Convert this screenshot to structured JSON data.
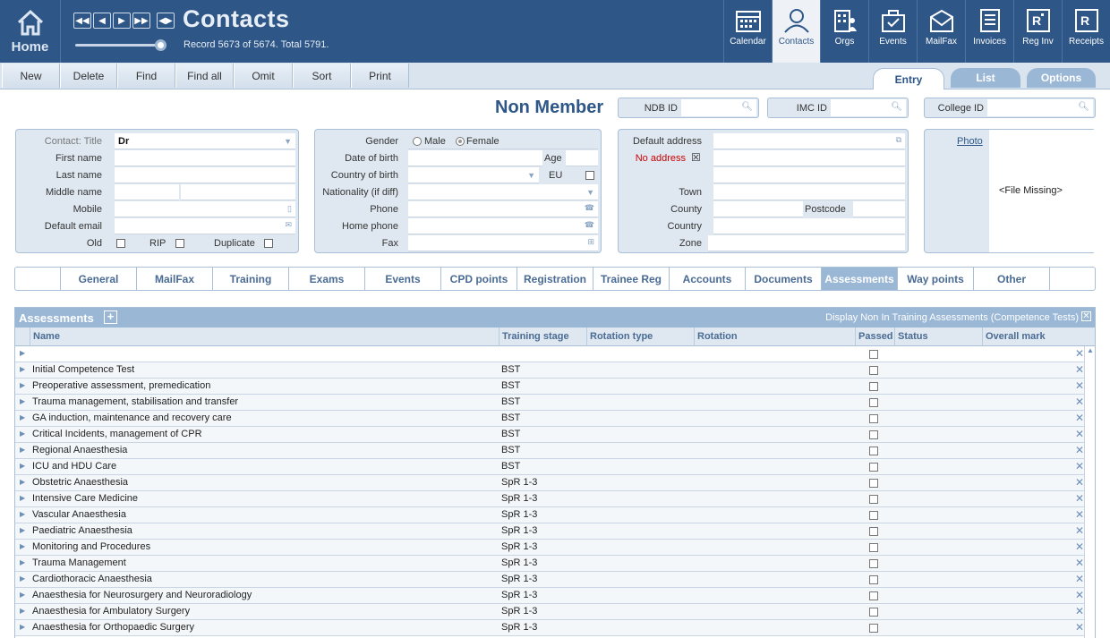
{
  "home_label": "Home",
  "page_title": "Contacts",
  "record_info": "Record 5673 of 5674. Total 5791.",
  "modules": [
    {
      "label": "Calendar",
      "icon": "calendar-icon"
    },
    {
      "label": "Contacts",
      "icon": "person-icon",
      "active": true
    },
    {
      "label": "Orgs",
      "icon": "building-icon"
    },
    {
      "label": "Events",
      "icon": "briefcase-icon"
    },
    {
      "label": "MailFax",
      "icon": "mail-icon"
    },
    {
      "label": "Invoices",
      "icon": "invoice-icon"
    },
    {
      "label": "Reg Inv",
      "icon": "reg-invoice-icon"
    },
    {
      "label": "Receipts",
      "icon": "receipt-icon"
    }
  ],
  "toolbar": {
    "new": "New",
    "delete": "Delete",
    "find": "Find",
    "find_all": "Find all",
    "omit": "Omit",
    "sort": "Sort",
    "print": "Print"
  },
  "view_tabs": {
    "entry": "Entry",
    "list": "List",
    "options": "Options"
  },
  "member_status": "Non Member",
  "ids": {
    "ndb": "NDB ID",
    "imc": "IMC ID",
    "college": "College ID"
  },
  "contact": {
    "title_label": "Contact: Title",
    "title_value": "Dr",
    "first_name": "First name",
    "last_name": "Last name",
    "middle_name": "Middle name",
    "mobile": "Mobile",
    "default_email": "Default email",
    "old": "Old",
    "rip": "RIP",
    "duplicate": "Duplicate"
  },
  "personal": {
    "gender": "Gender",
    "male": "Male",
    "female": "Female",
    "dob": "Date of birth",
    "age": "Age",
    "country_of_birth": "Country of birth",
    "eu": "EU",
    "nationality": "Nationality (if diff)",
    "phone": "Phone",
    "home_phone": "Home phone",
    "fax": "Fax"
  },
  "address": {
    "default_address": "Default address",
    "no_address": "No address",
    "town": "Town",
    "county": "County",
    "postcode": "Postcode",
    "country": "Country",
    "zone": "Zone"
  },
  "photo": {
    "label": "Photo",
    "missing": "<File Missing>"
  },
  "subtabs": [
    "",
    "General",
    "MailFax",
    "Training",
    "Exams",
    "Events",
    "CPD points",
    "Registration",
    "Trainee Reg",
    "Accounts",
    "Documents",
    "Assessments",
    "Way points",
    "Other",
    ""
  ],
  "active_subtab": "Assessments",
  "assessments": {
    "title": "Assessments",
    "display_toggle": "Display Non In Training Assessments (Competence Tests)",
    "columns": [
      "Name",
      "Training stage",
      "Rotation type",
      "Rotation",
      "Passed",
      "Status",
      "Overall mark"
    ],
    "rows": [
      {
        "name": "",
        "stage": ""
      },
      {
        "name": "Initial Competence Test",
        "stage": "BST"
      },
      {
        "name": "Preoperative assessment, premedication",
        "stage": "BST"
      },
      {
        "name": "Trauma management, stabilisation and transfer",
        "stage": "BST"
      },
      {
        "name": "GA induction, maintenance and recovery care",
        "stage": "BST"
      },
      {
        "name": "Critical Incidents, management of CPR",
        "stage": "BST"
      },
      {
        "name": "Regional Anaesthesia",
        "stage": "BST"
      },
      {
        "name": "ICU and HDU Care",
        "stage": "BST"
      },
      {
        "name": "Obstetric Anaesthesia",
        "stage": "SpR 1-3"
      },
      {
        "name": "Intensive Care Medicine",
        "stage": "SpR 1-3"
      },
      {
        "name": "Vascular Anaesthesia",
        "stage": "SpR 1-3"
      },
      {
        "name": "Paediatric Anaesthesia",
        "stage": "SpR 1-3"
      },
      {
        "name": "Monitoring and Procedures",
        "stage": "SpR 1-3"
      },
      {
        "name": "Trauma Management",
        "stage": "SpR 1-3"
      },
      {
        "name": "Cardiothoracic Anaesthesia",
        "stage": "SpR 1-3"
      },
      {
        "name": "Anaesthesia for Neurosurgery and Neuroradiology",
        "stage": "SpR 1-3"
      },
      {
        "name": "Anaesthesia for Ambulatory Surgery",
        "stage": "SpR 1-3"
      },
      {
        "name": "Anaesthesia for Orthopaedic Surgery",
        "stage": "SpR 1-3"
      }
    ]
  }
}
